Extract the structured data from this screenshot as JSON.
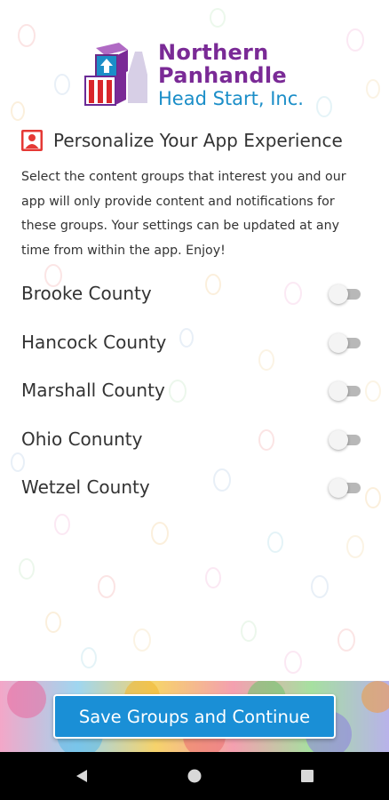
{
  "logo": {
    "line1": "Northern",
    "line2": "Panhandle",
    "line3": "Head Start, Inc."
  },
  "heading": {
    "icon": "person-icon",
    "title": "Personalize Your App Experience"
  },
  "intro": "Select the content groups that interest you and our app will only provide content and notifications for these groups. Your settings can be updated at any time from within the app. Enjoy!",
  "groups": [
    {
      "label": "Brooke County",
      "enabled": false
    },
    {
      "label": "Hancock County",
      "enabled": false
    },
    {
      "label": "Marshall County",
      "enabled": false
    },
    {
      "label": "Ohio Conunty",
      "enabled": false
    },
    {
      "label": "Wetzel County",
      "enabled": false
    }
  ],
  "actions": {
    "save_label": "Save Groups and Continue"
  },
  "navbar": {
    "back_icon": "back-triangle-icon",
    "home_icon": "home-circle-icon",
    "recents_icon": "recents-square-icon"
  },
  "colors": {
    "brand_purple": "#7a2a96",
    "brand_blue": "#1b8ec8",
    "button_blue": "#1a8fd6",
    "heading_icon_red": "#e53935"
  }
}
